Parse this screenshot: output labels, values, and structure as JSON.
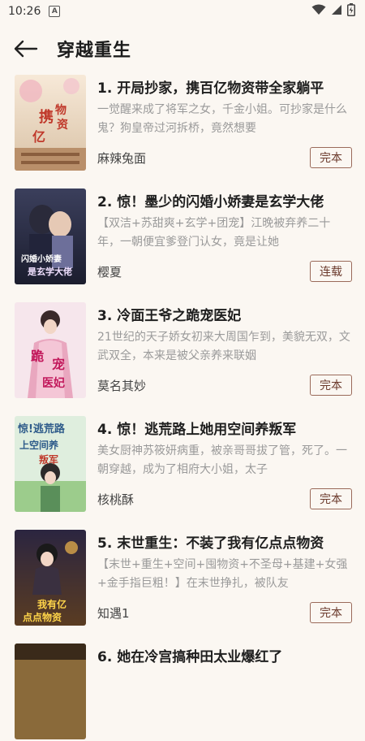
{
  "status_bar": {
    "time": "10:26",
    "notification_icon": "a-icon"
  },
  "header": {
    "title": "穿越重生",
    "back_icon": "back-arrow-icon"
  },
  "books": [
    {
      "title": "1. 开局抄家，携百亿物资带全家躺平",
      "description": "一觉醒来成了将军之女，千金小姐。可抄家是什么鬼？狗皇帝过河拆桥，竟然想要",
      "author": "麻辣兔面",
      "status": "完本",
      "cover_text": "携百亿物资"
    },
    {
      "title": "2. 惊！墨少的闪婚小娇妻是玄学大佬",
      "description": "【双洁+苏甜爽+玄学+团宠】江晚被弃养二十年，一朝便宜爹登门认女，竟是让她",
      "author": "樱夏",
      "status": "连载",
      "cover_text": "闪婚小娇妻是玄学大佬"
    },
    {
      "title": "3. 冷面王爷之跪宠医妃",
      "description": "21世纪的天子娇女初来大周国乍到，美貌无双，文武双全，本来是被父亲养来联姻",
      "author": "莫名其妙",
      "status": "完本",
      "cover_text": "跪宠医妃"
    },
    {
      "title": "4. 惊！逃荒路上她用空间养叛军",
      "description": "美女厨神苏筱妍病重，被亲哥哥拔了管，死了。一朝穿越，成为了相府大小姐，太子",
      "author": "核桃酥",
      "status": "完本",
      "cover_text": "惊！逃荒路上空间养叛军"
    },
    {
      "title": "5. 末世重生：不装了我有亿点点物资",
      "description": "【末世+重生+空间+囤物资+不圣母+基建+女强+金手指巨粗！】在末世挣扎，被队友",
      "author": "知遇1",
      "status": "完本",
      "cover_text": "我有亿点点物资"
    },
    {
      "title": "6. 她在冷宫搞种田太业爆红了",
      "description": "",
      "author": "",
      "status": "",
      "cover_text": ""
    }
  ]
}
